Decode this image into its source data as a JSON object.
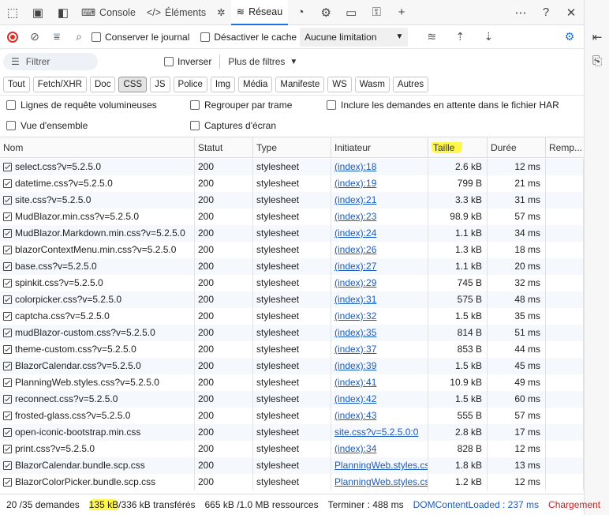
{
  "tabs": [
    {
      "label": "Console",
      "icon": "console-icon"
    },
    {
      "label": "Éléments",
      "icon": "elements-icon"
    },
    {
      "label": "",
      "icon": "bug-icon"
    },
    {
      "label": "Réseau",
      "icon": "wifi-icon",
      "active": true
    }
  ],
  "toolbar": {
    "preserve_log": "Conserver le journal",
    "disable_cache": "Désactiver le cache",
    "throttle": "Aucune limitation"
  },
  "filterbar": {
    "filter_placeholder": "Filtrer",
    "invert": "Inverser",
    "more_filters": "Plus de filtres"
  },
  "chips": [
    "Tout",
    "Fetch/XHR",
    "Doc",
    "CSS",
    "JS",
    "Police",
    "Img",
    "Média",
    "Manifeste",
    "WS",
    "Wasm",
    "Autres"
  ],
  "active_chip": "CSS",
  "options": {
    "large_rows": "Lignes de requête volumineuses",
    "group_by_frame": "Regrouper par trame",
    "include_pending": "Inclure les demandes en attente dans le fichier HAR",
    "overview": "Vue d'ensemble",
    "screenshots": "Captures d'écran"
  },
  "columns": {
    "name": "Nom",
    "status": "Statut",
    "type": "Type",
    "initiator": "Initiateur",
    "size": "Taille",
    "time": "Durée",
    "replacement": "Remp..."
  },
  "rows": [
    {
      "name": "select.css?v=5.2.5.0",
      "status": "200",
      "type": "stylesheet",
      "initiator": "(index):18",
      "size": "2.6 kB",
      "time": "12 ms"
    },
    {
      "name": "datetime.css?v=5.2.5.0",
      "status": "200",
      "type": "stylesheet",
      "initiator": "(index):19",
      "size": "799 B",
      "time": "21 ms"
    },
    {
      "name": "site.css?v=5.2.5.0",
      "status": "200",
      "type": "stylesheet",
      "initiator": "(index):21",
      "size": "3.3 kB",
      "time": "31 ms"
    },
    {
      "name": "MudBlazor.min.css?v=5.2.5.0",
      "status": "200",
      "type": "stylesheet",
      "initiator": "(index):23",
      "size": "98.9 kB",
      "time": "57 ms"
    },
    {
      "name": "MudBlazor.Markdown.min.css?v=5.2.5.0",
      "status": "200",
      "type": "stylesheet",
      "initiator": "(index):24",
      "size": "1.1 kB",
      "time": "34 ms"
    },
    {
      "name": "blazorContextMenu.min.css?v=5.2.5.0",
      "status": "200",
      "type": "stylesheet",
      "initiator": "(index):26",
      "size": "1.3 kB",
      "time": "18 ms"
    },
    {
      "name": "base.css?v=5.2.5.0",
      "status": "200",
      "type": "stylesheet",
      "initiator": "(index):27",
      "size": "1.1 kB",
      "time": "20 ms"
    },
    {
      "name": "spinkit.css?v=5.2.5.0",
      "status": "200",
      "type": "stylesheet",
      "initiator": "(index):29",
      "size": "745 B",
      "time": "32 ms"
    },
    {
      "name": "colorpicker.css?v=5.2.5.0",
      "status": "200",
      "type": "stylesheet",
      "initiator": "(index):31",
      "size": "575 B",
      "time": "48 ms"
    },
    {
      "name": "captcha.css?v=5.2.5.0",
      "status": "200",
      "type": "stylesheet",
      "initiator": "(index):32",
      "size": "1.5 kB",
      "time": "35 ms"
    },
    {
      "name": "mudBlazor-custom.css?v=5.2.5.0",
      "status": "200",
      "type": "stylesheet",
      "initiator": "(index):35",
      "size": "814 B",
      "time": "51 ms"
    },
    {
      "name": "theme-custom.css?v=5.2.5.0",
      "status": "200",
      "type": "stylesheet",
      "initiator": "(index):37",
      "size": "853 B",
      "time": "44 ms"
    },
    {
      "name": "BlazorCalendar.css?v=5.2.5.0",
      "status": "200",
      "type": "stylesheet",
      "initiator": "(index):39",
      "size": "1.5 kB",
      "time": "45 ms"
    },
    {
      "name": "PlanningWeb.styles.css?v=5.2.5.0",
      "status": "200",
      "type": "stylesheet",
      "initiator": "(index):41",
      "size": "10.9 kB",
      "time": "49 ms"
    },
    {
      "name": "reconnect.css?v=5.2.5.0",
      "status": "200",
      "type": "stylesheet",
      "initiator": "(index):42",
      "size": "1.5 kB",
      "time": "60 ms"
    },
    {
      "name": "frosted-glass.css?v=5.2.5.0",
      "status": "200",
      "type": "stylesheet",
      "initiator": "(index):43",
      "size": "555 B",
      "time": "57 ms"
    },
    {
      "name": "open-iconic-bootstrap.min.css",
      "status": "200",
      "type": "stylesheet",
      "initiator": "site.css?v=5.2.5.0:0",
      "size": "2.8 kB",
      "time": "17 ms"
    },
    {
      "name": "print.css?v=5.2.5.0",
      "status": "200",
      "type": "stylesheet",
      "initiator": "(index):34",
      "size": "828 B",
      "time": "12 ms"
    },
    {
      "name": "BlazorCalendar.bundle.scp.css",
      "status": "200",
      "type": "stylesheet",
      "initiator": "PlanningWeb.styles.css",
      "size": "1.8 kB",
      "time": "13 ms"
    },
    {
      "name": "BlazorColorPicker.bundle.scp.css",
      "status": "200",
      "type": "stylesheet",
      "initiator": "PlanningWeb.styles.css",
      "size": "1.2 kB",
      "time": "12 ms"
    }
  ],
  "status_bar": {
    "requests": "20 /35 demandes",
    "transferred_hl": "135 kB",
    "transferred_rest": "/336 kB transférés",
    "resources": "665 kB /1.0 MB ressources",
    "finish": "Terminer : 488 ms",
    "dom_loaded": "DOMContentLoaded : 237 ms",
    "load": "Chargement"
  }
}
